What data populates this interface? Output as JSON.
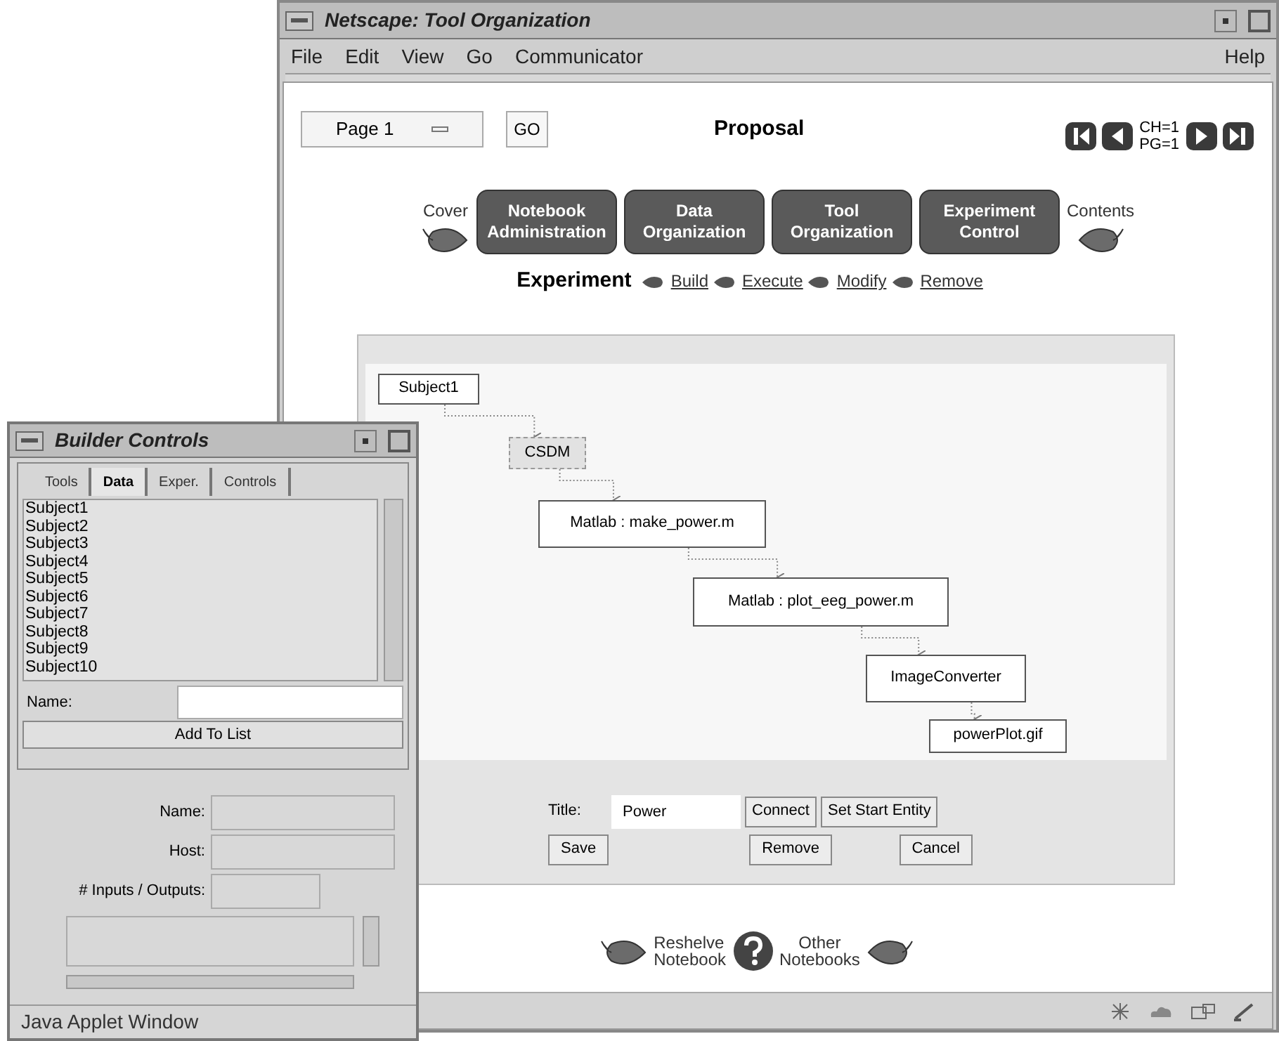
{
  "browser": {
    "title": "Netscape: Tool Organization",
    "menu": [
      "File",
      "Edit",
      "View",
      "Go",
      "Communicator"
    ],
    "help_menu": "Help",
    "page_select": {
      "value": "Page 1"
    },
    "go_button": "GO",
    "heading": "Proposal",
    "position": [
      "CH=1",
      "PG=1"
    ],
    "sections": {
      "left": "Cover",
      "right": "Contents",
      "buttons": [
        {
          "lines": [
            "Notebook",
            "Administration"
          ]
        },
        {
          "lines": [
            "Data",
            "Organization"
          ]
        },
        {
          "lines": [
            "Tool",
            "Organization"
          ]
        },
        {
          "lines": [
            "Experiment",
            "Control"
          ]
        }
      ]
    },
    "subnav": {
      "label": "Experiment",
      "links": [
        "Build",
        "Execute",
        "Modify",
        "Remove"
      ]
    },
    "diagram": {
      "nodes": [
        {
          "label": "Subject1",
          "selected": false
        },
        {
          "label": "CSDM",
          "selected": true
        },
        {
          "label": "Matlab : make_power.m",
          "selected": false
        },
        {
          "label": "Matlab : plot_eeg_power.m",
          "selected": false
        },
        {
          "label": "ImageConverter",
          "selected": false
        },
        {
          "label": "powerPlot.gif",
          "selected": false
        }
      ]
    },
    "form": {
      "title_label": "Title:",
      "title_value": "Power",
      "buttons": [
        "Connect",
        "Set Start Entity",
        "Save",
        "Remove",
        "Cancel"
      ]
    },
    "footer": {
      "left": [
        "Reshelve",
        "Notebook"
      ],
      "right": [
        "Other",
        "Notebooks"
      ]
    }
  },
  "builder": {
    "title": "Builder Controls",
    "tabs": [
      {
        "label": "Tools",
        "selected": false
      },
      {
        "label": "Data",
        "selected": true
      },
      {
        "label": "Exper.",
        "selected": false
      },
      {
        "label": "Controls",
        "selected": false
      }
    ],
    "items": [
      "Subject1",
      "Subject2",
      "Subject3",
      "Subject4",
      "Subject5",
      "Subject6",
      "Subject7",
      "Subject8",
      "Subject9",
      "Subject10"
    ],
    "name_label": "Name:",
    "add_button": "Add To List",
    "fields": [
      {
        "label": "Name:"
      },
      {
        "label": "Host:"
      },
      {
        "label": "# Inputs / Outputs:"
      }
    ],
    "status": "Java Applet Window"
  }
}
